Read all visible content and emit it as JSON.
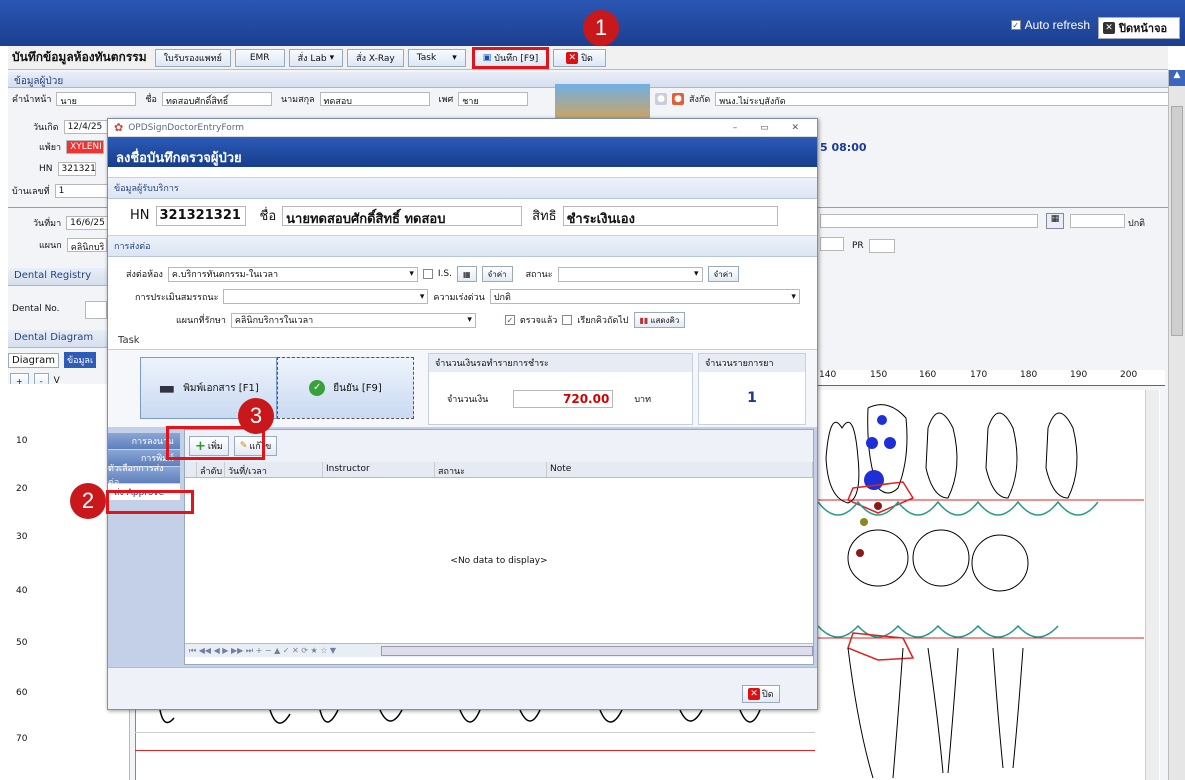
{
  "topbar": {
    "auto_refresh": "Auto refresh",
    "close_screen": "ปิดหน้าจอ"
  },
  "toolbar": {
    "title": "บันทึกข้อมูลห้องทันตกรรม",
    "buttons": [
      "ใบรับรองแพทย์",
      "EMR",
      "สั่ง Lab",
      "สั่ง X-Ray",
      "Task",
      "บันทึก [F9]",
      "ปิด"
    ]
  },
  "patient": {
    "section": "ข้อมูลผู้ป่วย",
    "prefix_label": "คำนำหน้า",
    "prefix": "นาย",
    "name_label": "ชื่อ",
    "name": "ทดสอบศักดิ์สิทธิ์",
    "surname_label": "นามสกุล",
    "surname": "ทดสอบ",
    "sex_label": "เพศ",
    "sex": "ชาย",
    "affiliation_label": "สังกัด",
    "affiliation": "พนง.ไม่ระบุสังกัด",
    "dob_label": "วันเกิด",
    "dob": "12/4/25",
    "allergy_label": "แพ้ยา",
    "allergy": "XYLENI",
    "hn_label": "HN",
    "hn": "3213213",
    "house_label": "บ้านเลขที่",
    "house": "1",
    "visit_label": "วันที่มา",
    "visit": "16/6/25",
    "dept_label": "แผนก",
    "dept": "คลินิกบริ",
    "time_text": "5 08:00",
    "pr_label": "PR",
    "status_right": "ปกติ"
  },
  "left_panel": {
    "dental_registry": "Dental Registry",
    "dental_no": "Dental No.",
    "dental_diagram": "Dental Diagram",
    "diagram_tab": "Diagram",
    "info_tab": "ข้อมูลเ",
    "zoom_label": "V"
  },
  "ruler": {
    "ticks": [
      "140",
      "150",
      "160",
      "170",
      "180",
      "190",
      "200"
    ]
  },
  "ruler_left": {
    "ticks": [
      "10",
      "20",
      "30",
      "40",
      "50",
      "60",
      "70"
    ]
  },
  "modal": {
    "window_title": "OPDSignDoctorEntryForm",
    "header": "ลงชื่อบันทึกตรวจผู้ป่วย",
    "group_patient": "ข้อมูลผู้รับบริการ",
    "hn_label": "HN",
    "hn": "321321321",
    "name_label": "ชื่อ",
    "name": "นายทดสอบศักดิ์สิทธิ์ ทดสอบ",
    "right_label": "สิทธิ",
    "right": "ชำระเงินเอง",
    "group_referral": "การส่งต่อ",
    "send_room_label": "ส่งต่อห้อง",
    "send_room": "ค.บริการทันตกรรม-ในเวลา",
    "is_label": "I.S.",
    "remember_btn": "จำค่า",
    "status_label": "สถานะ",
    "assess_label": "การประเมินสมรรถนะ",
    "urgency_label": "ความเร่งด่วน",
    "urgency": "ปกติ",
    "treat_dept_label": "แผนกที่รักษา",
    "treat_dept": "คลินิกบริการในเวลา",
    "checked_label": "ตรวจแล้ว",
    "next_queue_label": "เรียกคิวถัดไป",
    "show_queue_btn": "แสดงคิว",
    "task_tab": "Task",
    "print_btn": "พิมพ์เอกสาร [F1]",
    "confirm_btn": "ยืนยัน [F9]",
    "pay_group": "จำนวนเงินรอทำรายการชำระ",
    "amount_label": "จำนวนเงิน",
    "amount": "720.00",
    "baht": "บาท",
    "drug_group": "จำนวนรายการยา",
    "drug_count": "1",
    "side_tabs": [
      "การลงนาม",
      "การพิมพ์",
      "ตัวเลือกการส่งต่อ",
      "ส่ง Approve"
    ],
    "add_btn": "เพิ่ม",
    "edit_btn": "แก้ไข",
    "columns": [
      "ลำดับ",
      "วันที่/เวลา",
      "Instructor",
      "สถานะ",
      "Note"
    ],
    "empty_text": "<No data to display>",
    "close_btn": "ปิด"
  },
  "annotations": [
    "1",
    "2",
    "3"
  ],
  "colors": {
    "header_blue": "#1c3f8f",
    "annotation_red": "#c9181b",
    "amount_red": "#d40000"
  }
}
